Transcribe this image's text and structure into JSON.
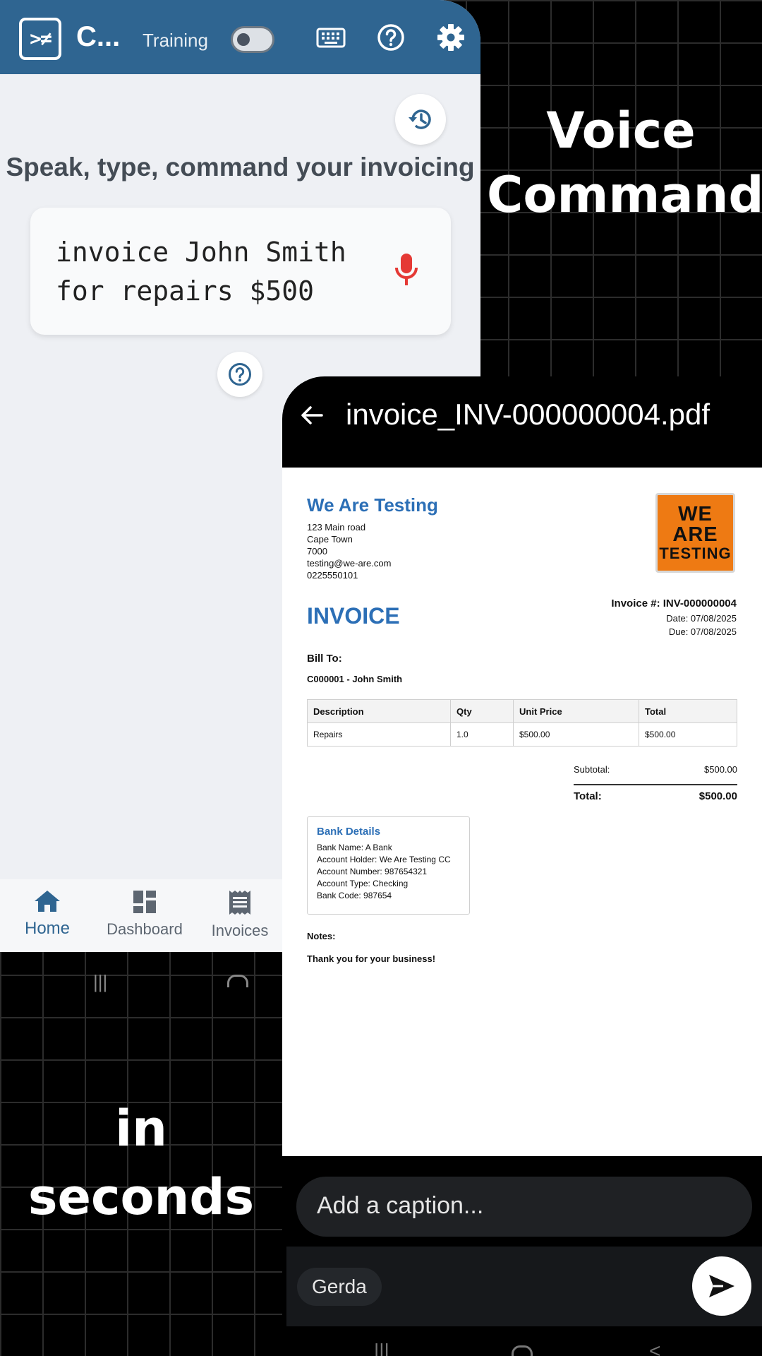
{
  "promo": {
    "top_line1": "Voice",
    "top_line2": "Command",
    "bottom_line1": "in",
    "bottom_line2": "seconds"
  },
  "app": {
    "logo_glyph": ">≠",
    "title": "C...",
    "training_label": "Training",
    "training_enabled": false,
    "headline": "Speak, type, command your invoicing",
    "command_text": "invoice John Smith for repairs $500",
    "icons": [
      "keyboard-icon",
      "help-icon",
      "settings-icon",
      "history-icon",
      "mic-icon"
    ],
    "colors": {
      "appbar": "#2f6591",
      "mic": "#e53935",
      "background": "#eef0f4"
    },
    "nav": [
      {
        "label": "Home",
        "icon": "home-icon",
        "active": true
      },
      {
        "label": "Dashboard",
        "icon": "dashboard-icon",
        "active": false
      },
      {
        "label": "Invoices",
        "icon": "receipt-icon",
        "active": false
      }
    ]
  },
  "viewer": {
    "title": "invoice_INV-000000004.pdf",
    "caption_placeholder": "Add a caption...",
    "recipient": "Gerda"
  },
  "invoice": {
    "company": "We Are Testing",
    "address": [
      "123 Main road",
      "Cape Town",
      "7000",
      "testing@we-are.com",
      "0225550101"
    ],
    "logo_lines": [
      "WE",
      "ARE",
      "TESTING"
    ],
    "heading": "INVOICE",
    "number": "Invoice #: INV-000000004",
    "date": "Date: 07/08/2025",
    "due": "Due: 07/08/2025",
    "bill_to_label": "Bill To:",
    "bill_to": "C000001 - John Smith",
    "columns": [
      "Description",
      "Qty",
      "Unit Price",
      "Total"
    ],
    "rows": [
      [
        "Repairs",
        "1.0",
        "$500.00",
        "$500.00"
      ]
    ],
    "subtotal_label": "Subtotal:",
    "subtotal": "$500.00",
    "total_label": "Total:",
    "total": "$500.00",
    "bank_title": "Bank Details",
    "bank": [
      "Bank Name: A Bank",
      "Account Holder: We Are Testing CC",
      "Account Number: 987654321",
      "Account Type: Checking",
      "Bank Code: 987654"
    ],
    "notes_label": "Notes:",
    "notes": "Thank you for your business!",
    "colors": {
      "accent": "#2c6fb6",
      "logo_bg": "#ee7a13"
    }
  }
}
